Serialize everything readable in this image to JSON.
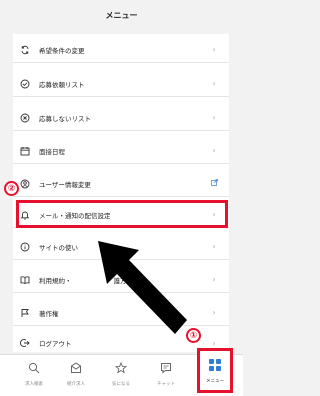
{
  "header": {
    "title": "メニュー"
  },
  "menu_items": [
    {
      "label": "希望条件の変更",
      "icon": "sync-icon"
    },
    {
      "label": "応募依頼リスト",
      "icon": "check-circle-icon"
    },
    {
      "label": "応募しないリスト",
      "icon": "x-circle-icon"
    },
    {
      "label": "面接日程",
      "icon": "calendar-icon"
    },
    {
      "label": "ユーザー情報変更",
      "icon": "user-circle-icon"
    },
    {
      "label": "メール・通知の配信設定",
      "icon": "bell-icon"
    },
    {
      "label": "サイトの使い",
      "icon": "info-icon"
    },
    {
      "label": "利用規約・",
      "label_tail": "護方針",
      "icon": "book-icon"
    },
    {
      "label": "著作権",
      "icon": "flag-icon"
    },
    {
      "label": "ログアウト",
      "icon": "logout-icon"
    }
  ],
  "annotations": {
    "callout_1": "①",
    "callout_2": "②"
  },
  "tabbar": [
    {
      "label": "求人検索",
      "icon": "search-icon"
    },
    {
      "label": "紹介求人",
      "icon": "mail-icon"
    },
    {
      "label": "気になる",
      "icon": "star-icon"
    },
    {
      "label": "チャット",
      "icon": "chat-icon"
    },
    {
      "label": "メニュー",
      "icon": "grid-icon"
    }
  ],
  "colors": {
    "annotation_red": "#e8112d",
    "menu_blue": "#2a7dd8"
  }
}
